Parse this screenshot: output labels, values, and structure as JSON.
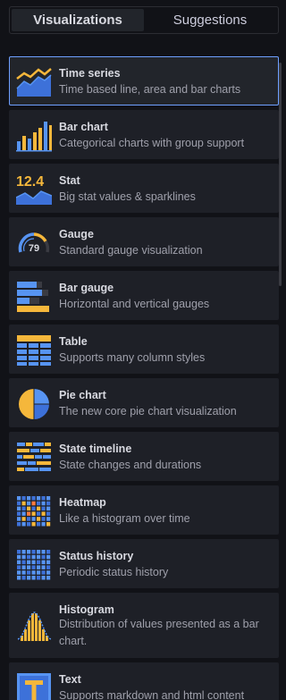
{
  "tabs": [
    {
      "label": "Visualizations",
      "active": true
    },
    {
      "label": "Suggestions",
      "active": false
    }
  ],
  "visualizations": [
    {
      "title": "Time series",
      "description": "Time based line, area and bar charts",
      "icon": "time-series-icon",
      "selected": true
    },
    {
      "title": "Bar chart",
      "description": "Categorical charts with group support",
      "icon": "bar-chart-icon"
    },
    {
      "title": "Stat",
      "description": "Big stat values & sparklines",
      "icon": "stat-icon",
      "icon_text": "12.4"
    },
    {
      "title": "Gauge",
      "description": "Standard gauge visualization",
      "icon": "gauge-icon",
      "icon_text": "79"
    },
    {
      "title": "Bar gauge",
      "description": "Horizontal and vertical gauges",
      "icon": "bar-gauge-icon"
    },
    {
      "title": "Table",
      "description": "Supports many column styles",
      "icon": "table-icon"
    },
    {
      "title": "Pie chart",
      "description": "The new core pie chart visualization",
      "icon": "pie-chart-icon"
    },
    {
      "title": "State timeline",
      "description": "State changes and durations",
      "icon": "state-timeline-icon"
    },
    {
      "title": "Heatmap",
      "description": "Like a histogram over time",
      "icon": "heatmap-icon"
    },
    {
      "title": "Status history",
      "description": "Periodic status history",
      "icon": "status-history-icon"
    },
    {
      "title": "Histogram",
      "description": "Distribution of values presented as a bar chart.",
      "icon": "histogram-icon"
    },
    {
      "title": "Text",
      "description": "Supports markdown and html content",
      "icon": "text-icon"
    }
  ],
  "colors": {
    "accent_yellow": "#f5b73b",
    "accent_blue": "#5794f2",
    "selected_border": "#6e9fff",
    "card_bg": "#1e2027",
    "page_bg": "#111217"
  }
}
